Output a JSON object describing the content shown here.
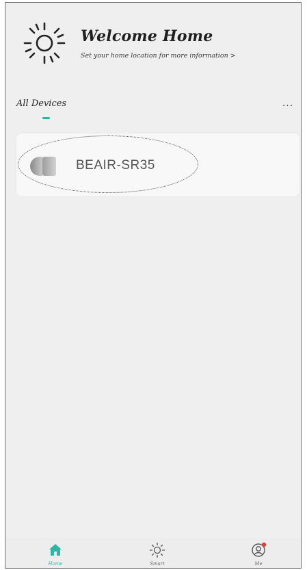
{
  "header": {
    "title": "Welcome Home",
    "subtitle": "Set your home location for more information >"
  },
  "section": {
    "title": "All Devices",
    "more_label": "..."
  },
  "devices": [
    {
      "name": "BEAIR-SR35",
      "icon": "sensor-device-icon"
    }
  ],
  "tabs": [
    {
      "label": "Home",
      "icon": "home-icon",
      "active": true
    },
    {
      "label": "Smart",
      "icon": "sun-icon",
      "active": false
    },
    {
      "label": "Me",
      "icon": "profile-icon",
      "active": false
    }
  ],
  "colors": {
    "accent": "#2fb6a3",
    "background": "#efefef",
    "card": "#f8f8f8",
    "notification": "#e53935"
  }
}
